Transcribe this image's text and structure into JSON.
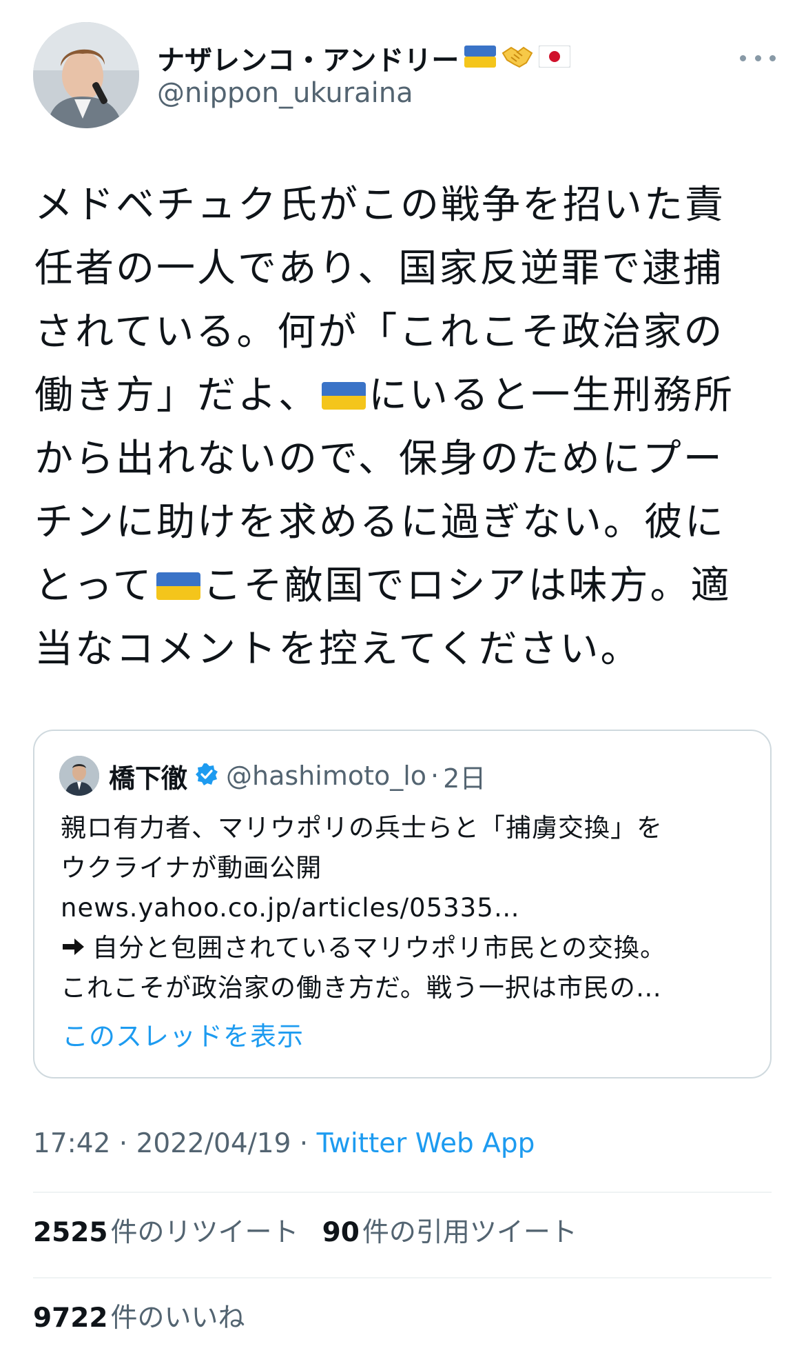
{
  "author": {
    "name": "ナザレンコ・アンドリー",
    "name_emojis": [
      "ukraine-flag",
      "handshake",
      "japan-flag"
    ],
    "handle": "@nippon_ukuraina"
  },
  "tweet": {
    "lines": [
      [
        "メドベチュク氏がこの戦争を招いた責"
      ],
      [
        "任者の一人であり、国家反逆罪で逮捕"
      ],
      [
        "されている。何が「これこそ政治家の"
      ],
      [
        "働き方」だよ、",
        "flag",
        "にいると一生刑務所"
      ],
      [
        "から出れないので、保身のためにプー"
      ],
      [
        "チンに助けを求めるに過ぎない。彼に"
      ],
      [
        "とって",
        "flag",
        "こそ敵国でロシアは味方。適"
      ],
      [
        "当なコメントを控えてください。"
      ]
    ]
  },
  "quote": {
    "name": "橋下徹",
    "handle": "@hashimoto_lo",
    "separator": "·",
    "time": "2日",
    "line1": "親ロ有力者、マリウポリの兵士らと「捕虜交換」を",
    "line2": "ウクライナが動画公開",
    "line3": "news.yahoo.co.jp/articles/05335…",
    "line4": "自分と包囲されているマリウポリ市民との交換。",
    "line5": "これこそが政治家の働き方だ。戦う一択は市民の…",
    "show_thread": "このスレッドを表示"
  },
  "meta": {
    "time": "17:42",
    "sep1": " · ",
    "date": "2022/04/19",
    "sep2": " · ",
    "source": "Twitter Web App"
  },
  "stats": {
    "retweets": "2525",
    "retweets_label": "件のリツイート",
    "quotes": "90",
    "quotes_label": "件の引用ツイート",
    "likes": "9722",
    "likes_label": "件のいいね"
  },
  "colors": {
    "text": "#0f1419",
    "secondary": "#536471",
    "link": "#1d9bf0",
    "border": "#cfd9de",
    "ua_blue": "#3a73c7",
    "ua_yellow": "#f4c51b"
  }
}
